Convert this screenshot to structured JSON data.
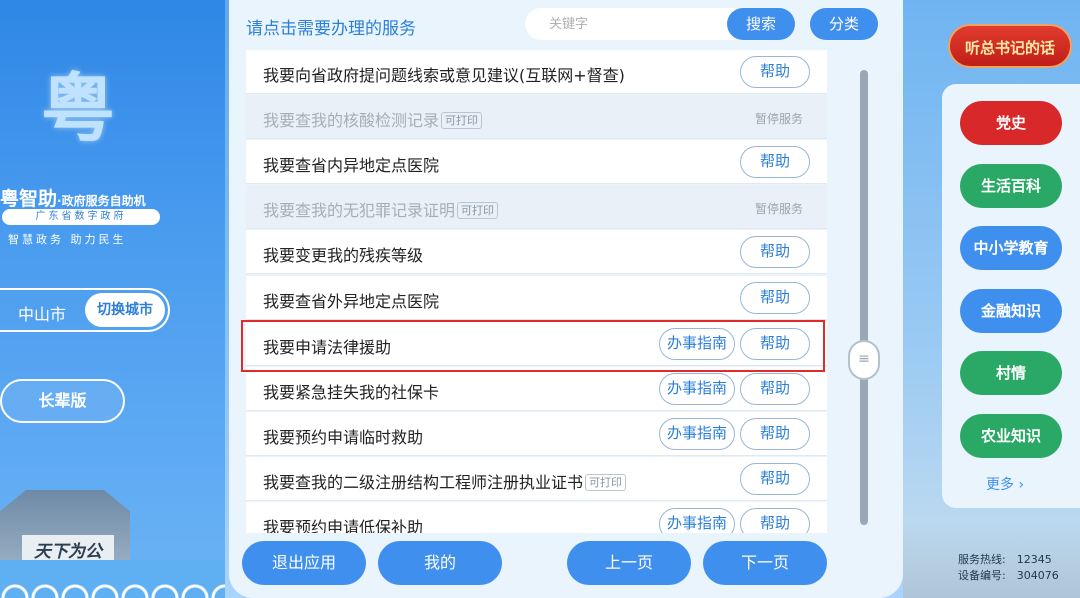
{
  "sidebar": {
    "logo_char": "粤",
    "brand_name": "粤智助",
    "brand_tag": "·政府服务自助机",
    "brand_sub": "广东省数字政府",
    "slogan": "智慧政务 助力民生",
    "city": "中山市",
    "switch_city": "切换城市",
    "elder_mode": "长辈版",
    "sign_text": "天下为公"
  },
  "header": {
    "prompt": "请点击需要办理的服务",
    "search_placeholder": "关键字",
    "search_label": "搜索",
    "category_label": "分类"
  },
  "list": {
    "help_label": "帮助",
    "guide_label": "办事指南",
    "print_label": "可打印",
    "paused_label": "暂停服务",
    "items": [
      {
        "label": "我要向省政府提问题线索或意见建议(互联网+督查)"
      },
      {
        "label": "我要查我的核酸检测记录"
      },
      {
        "label": "我要查省内异地定点医院"
      },
      {
        "label": "我要查我的无犯罪记录证明"
      },
      {
        "label": "我要变更我的残疾等级"
      },
      {
        "label": "我要查省外异地定点医院"
      },
      {
        "label": "我要申请法律援助"
      },
      {
        "label": "我要紧急挂失我的社保卡"
      },
      {
        "label": "我要预约申请临时救助"
      },
      {
        "label": "我要查我的二级注册结构工程师注册执业证书"
      },
      {
        "label": "我要预约申请低保补助"
      }
    ]
  },
  "footer": {
    "exit": "退出应用",
    "mine": "我的",
    "prev": "上一页",
    "next": "下一页"
  },
  "right": {
    "xi_label": "听总书记的话",
    "categories": [
      {
        "label": "党史",
        "color": "#d8282a"
      },
      {
        "label": "生活百科",
        "color": "#2aa866"
      },
      {
        "label": "中小学教育",
        "color": "#3f8fee"
      },
      {
        "label": "金融知识",
        "color": "#3f8fee"
      },
      {
        "label": "村情",
        "color": "#2aa866"
      },
      {
        "label": "农业知识",
        "color": "#2aa866"
      }
    ],
    "more": "更多 ›",
    "hotline": "服务热线:　12345",
    "device": "设备编号:　304076"
  }
}
